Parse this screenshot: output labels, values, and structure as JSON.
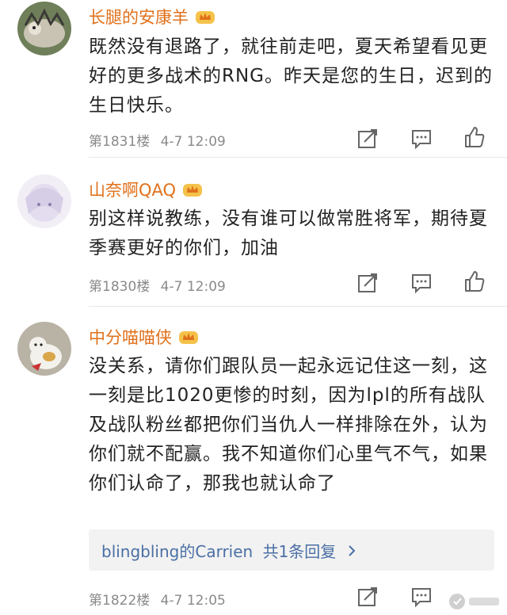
{
  "comments": [
    {
      "username": "长腿的安康羊",
      "content": "既然没有退路了，就往前走吧，夏天希望看见更好的更多战术的RNG。昨天是您的生日，迟到的生日快乐。",
      "floor": "第1831楼",
      "time": "4-7 12:09"
    },
    {
      "username": "山奈啊QAQ",
      "content": "别这样说教练，没有谁可以做常胜将军，期待夏季赛更好的你们，加油",
      "floor": "第1830楼",
      "time": "4-7 12:09"
    },
    {
      "username": "中分喵喵侠",
      "content": "没关系，请你们跟队员一起永远记住这一刻，这一刻是比1020更惨的时刻，因为lpl的所有战队及战队粉丝都把你们当仇人一样排除在外，认为你们就不配赢。我不知道你们心里气不气，如果你们认命了，那我也就认命了",
      "reply": {
        "name": "blingbling的Carrien",
        "count": "共1条回复"
      },
      "floor": "第1822楼",
      "time": "4-7 12:05"
    }
  ],
  "icons": {
    "badge": "vip-crown-icon",
    "share": "share-icon",
    "comment": "comment-icon",
    "like": "like-icon",
    "chevron": "chevron-right-icon"
  },
  "colors": {
    "username": "#e0701a",
    "reply_link": "#4a6fa5",
    "meta": "#8a8a8a"
  }
}
